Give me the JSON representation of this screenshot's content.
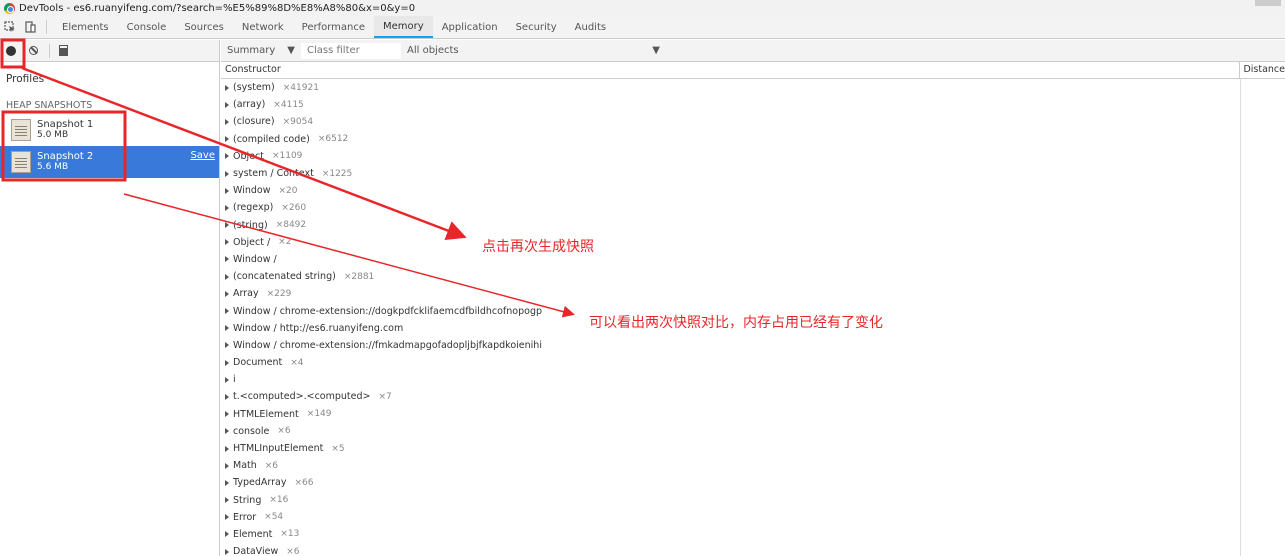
{
  "window": {
    "title": "DevTools - es6.ruanyifeng.com/?search=%E5%89%8D%E8%A8%80&x=0&y=0"
  },
  "tabs": [
    {
      "label": "Elements",
      "active": false
    },
    {
      "label": "Console",
      "active": false
    },
    {
      "label": "Sources",
      "active": false
    },
    {
      "label": "Network",
      "active": false
    },
    {
      "label": "Performance",
      "active": false
    },
    {
      "label": "Memory",
      "active": true
    },
    {
      "label": "Application",
      "active": false
    },
    {
      "label": "Security",
      "active": false
    },
    {
      "label": "Audits",
      "active": false
    }
  ],
  "left": {
    "profiles_label": "Profiles",
    "heap_header": "HEAP SNAPSHOTS",
    "snapshots": [
      {
        "name": "Snapshot 1",
        "size": "5.0 MB",
        "selected": false
      },
      {
        "name": "Snapshot 2",
        "size": "5.6 MB",
        "selected": true,
        "save_label": "Save"
      }
    ]
  },
  "toolbar": {
    "summary_label": "Summary",
    "class_filter_placeholder": "Class filter",
    "objects_label": "All objects"
  },
  "table": {
    "constructor_header": "Constructor",
    "distance_header": "Distance",
    "rows": [
      {
        "name": "(system)",
        "count": "×41921"
      },
      {
        "name": "(array)",
        "count": "×4115"
      },
      {
        "name": "(closure)",
        "count": "×9054"
      },
      {
        "name": "(compiled code)",
        "count": "×6512"
      },
      {
        "name": "Object",
        "count": "×1109"
      },
      {
        "name": "system / Context",
        "count": "×1225"
      },
      {
        "name": "Window",
        "count": "×20"
      },
      {
        "name": "(regexp)",
        "count": "×260"
      },
      {
        "name": "(string)",
        "count": "×8492"
      },
      {
        "name": "Object /",
        "count": "×2"
      },
      {
        "name": "Window /",
        "count": ""
      },
      {
        "name": "(concatenated string)",
        "count": "×2881"
      },
      {
        "name": "Array",
        "count": "×229"
      },
      {
        "name": "Window / chrome-extension://dogkpdfcklifaemcdfbildhcofnopogp",
        "count": ""
      },
      {
        "name": "Window / http://es6.ruanyifeng.com",
        "count": ""
      },
      {
        "name": "Window / chrome-extension://fmkadmapgofadopljbjfkapdkoienihi",
        "count": ""
      },
      {
        "name": "Document",
        "count": "×4"
      },
      {
        "name": "i",
        "count": ""
      },
      {
        "name": "t.<computed>.<computed>",
        "count": "×7"
      },
      {
        "name": "HTMLElement",
        "count": "×149"
      },
      {
        "name": "console",
        "count": "×6"
      },
      {
        "name": "HTMLInputElement",
        "count": "×5"
      },
      {
        "name": "Math",
        "count": "×6"
      },
      {
        "name": "TypedArray",
        "count": "×66"
      },
      {
        "name": "String",
        "count": "×16"
      },
      {
        "name": "Error",
        "count": "×54"
      },
      {
        "name": "Element",
        "count": "×13"
      },
      {
        "name": "DataView",
        "count": "×6"
      }
    ]
  },
  "annotations": {
    "note1": "点击再次生成快照",
    "note2": "可以看出两次快照对比，内存占用已经有了变化",
    "color": "#e8262a"
  },
  "colors": {
    "accent": "#03a9f4",
    "selection": "#3879d9"
  }
}
